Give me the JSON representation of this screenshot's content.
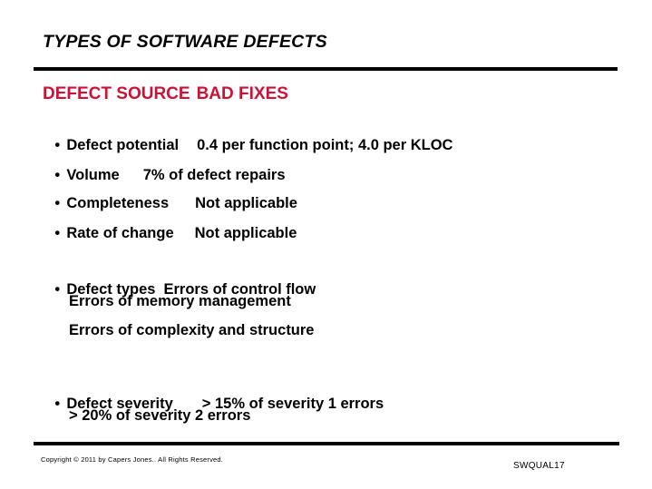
{
  "slide": {
    "title": "TYPES OF SOFTWARE DEFECTS",
    "section_heading_left": "DEFECT SOURCE",
    "section_heading_right": "BAD FIXES",
    "accent_color": "#cc1236",
    "bullet_glyph": "•",
    "metrics": [
      {
        "label": "Defect potential",
        "value": "0.4 per function point; 4.0 per KLOC"
      },
      {
        "label": "Volume",
        "value": "7% of defect repairs"
      },
      {
        "label": "Completeness",
        "value": "Not applicable"
      },
      {
        "label": "Rate of change",
        "value": "Not applicable"
      }
    ],
    "defect_types": {
      "label": "Defect types",
      "first": "Errors of control flow",
      "additional": [
        "Errors of memory management",
        "Errors of complexity and structure"
      ]
    },
    "defect_severity": {
      "label": "Defect severity",
      "first": "> 15% of severity 1 errors",
      "additional": [
        "> 20% of severity 2 errors"
      ]
    },
    "footer": {
      "copyright": "Copyright © 2011 by Capers Jones.. All Rights Reserved.",
      "code": "SWQUAL17"
    }
  }
}
